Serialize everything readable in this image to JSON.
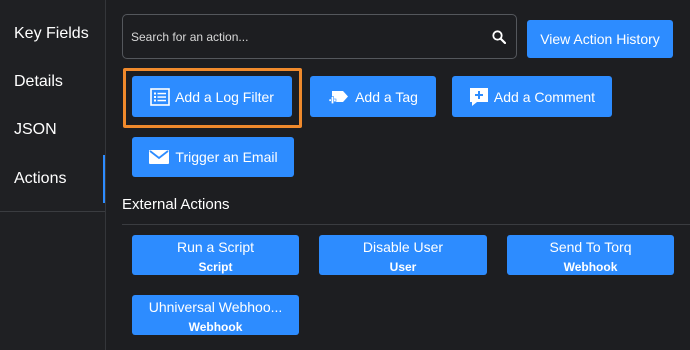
{
  "sidebar": {
    "items": [
      {
        "label": "Key Fields"
      },
      {
        "label": "Details"
      },
      {
        "label": "JSON"
      },
      {
        "label": "Actions",
        "active": true
      }
    ]
  },
  "search": {
    "placeholder": "Search for an action...",
    "value": "",
    "icon": "search-icon"
  },
  "header": {
    "history_button": "View Action History"
  },
  "actions": {
    "log_filter": {
      "label": "Add a Log Filter",
      "icon": "list-icon"
    },
    "tag": {
      "label": "Add a Tag",
      "icon": "tag-plus-icon"
    },
    "comment": {
      "label": "Add a Comment",
      "icon": "comment-plus-icon"
    },
    "email": {
      "label": "Trigger an Email",
      "icon": "envelope-icon"
    }
  },
  "external": {
    "title": "External Actions",
    "items": [
      {
        "name": "Run a Script",
        "type": "Script"
      },
      {
        "name": "Disable User",
        "type": "User"
      },
      {
        "name": "Send To Torq",
        "type": "Webhook"
      },
      {
        "name": "Uhniversal Webhoo...",
        "type": "Webhook"
      }
    ]
  },
  "colors": {
    "background": "#1d1e21",
    "accent": "#2d8cff",
    "highlight": "#f08a2c"
  }
}
